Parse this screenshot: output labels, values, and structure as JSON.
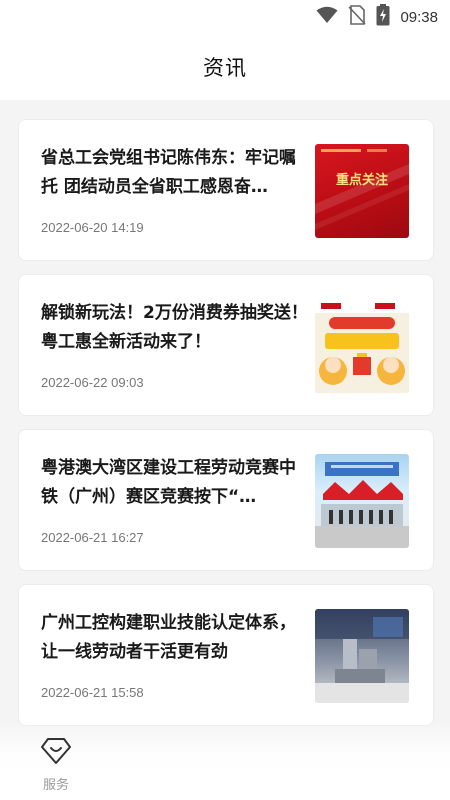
{
  "statusbar": {
    "time": "09:38",
    "icons": [
      "wifi-icon",
      "no-sim-icon",
      "battery-charging-icon"
    ]
  },
  "header": {
    "title": "资讯"
  },
  "news": [
    {
      "headline": "省总工会党组书记陈伟东：牢记嘱托 团结动员全省职工感恩奋…",
      "date": "2022-06-20 14:19",
      "thumb_text": "重点关注"
    },
    {
      "headline": "解锁新玩法！2万份消费券抽奖送！粤工惠全新活动来了！",
      "date": "2022-06-22 09:03",
      "thumb_text": "6月 粤工惠专区 福利"
    },
    {
      "headline": "粤港澳大湾区建设工程劳动竞赛中铁（广州）赛区竞赛按下“…",
      "date": "2022-06-21 16:27",
      "thumb_text": ""
    },
    {
      "headline": "广州工控构建职业技能认定体系，让一线劳动者干活更有劲",
      "date": "2022-06-21 15:58",
      "thumb_text": ""
    }
  ],
  "bottom_nav": {
    "service_label": "服务",
    "service_icon": "diamond-heart-icon"
  },
  "colors": {
    "background": "#f4f4f4",
    "card": "#ffffff",
    "date_text": "#777777",
    "thumb_red": "#c8101a"
  }
}
